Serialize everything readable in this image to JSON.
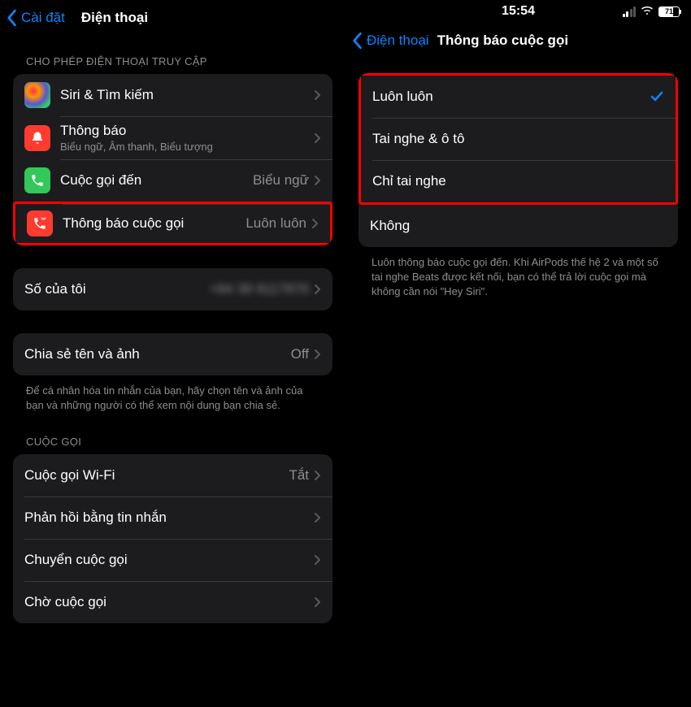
{
  "left": {
    "back_label": "Cài đặt",
    "title": "Điện thoại",
    "section1_header": "CHO PHÉP ĐIỆN THOẠI TRUY CẬP",
    "siri_label": "Siri & Tìm kiếm",
    "notifications_label": "Thông báo",
    "notifications_sub": "Biểu ngữ, Âm thanh, Biểu tượng",
    "incoming_label": "Cuộc gọi đến",
    "incoming_value": "Biểu ngữ",
    "announce_label": "Thông báo cuộc gọi",
    "announce_value": "Luôn luôn",
    "my_number_label": "Số của tôi",
    "my_number_value": "+84 39 9117870",
    "share_label": "Chia sẻ tên và ảnh",
    "share_value": "Off",
    "share_footer": "Để cá nhân hóa tin nhắn của bạn, hãy chọn tên và ảnh của bạn và những người có thể xem nội dung bạn chia sẻ.",
    "section3_header": "CUỘC GỌI",
    "wifi_call_label": "Cuộc gọi Wi-Fi",
    "wifi_call_value": "Tắt",
    "respond_label": "Phản hồi bằng tin nhắn",
    "forward_label": "Chuyển cuộc gọi",
    "waiting_label": "Chờ cuộc gọi"
  },
  "right": {
    "status_time": "15:54",
    "battery_pct": "71",
    "back_label": "Điện thoại",
    "title": "Thông báo cuộc gọi",
    "opt_always": "Luôn luôn",
    "opt_headphones_car": "Tai nghe & ô tô",
    "opt_headphones_only": "Chỉ tai nghe",
    "opt_never": "Không",
    "footer_text": "Luôn thông báo cuộc gọi đến. Khi AirPods thế hệ 2 và một số tai nghe Beats được kết nối, bạn có thể trả lời cuộc gọi mà không cần nói \"Hey Siri\"."
  }
}
